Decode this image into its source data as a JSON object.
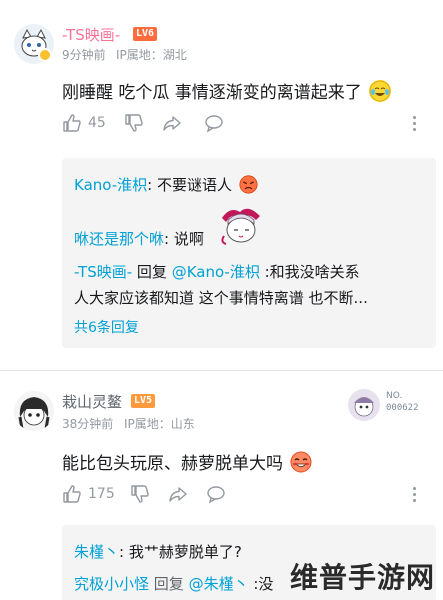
{
  "comments": [
    {
      "username": "-TS映画-",
      "level": "LV6",
      "time": "9分钟前",
      "ip": "IP属地：湖北",
      "content": "刚睡醒 吃个瓜 事情逐渐变的离谱起来了",
      "likes": "45",
      "emoji": "laughing-tears-emoji",
      "replies": [
        {
          "user": "Kano-淮枳",
          "sep": ": ",
          "text": "不要谜语人",
          "emoji": "angry-emoji"
        },
        {
          "user": "咻还是那个咻",
          "sep": ": ",
          "text": "说啊",
          "sticker": "anime-girl-sticker"
        },
        {
          "user": "-TS映画-",
          "mid": " 回复 ",
          "mention": "@Kano-淮枳",
          "text": " :和我没啥关系",
          "text2": "人大家应该都知道 这个事情特离谱 也不断..."
        }
      ],
      "more_replies": "共6条回复"
    },
    {
      "username": "栽山灵鳌",
      "level": "LV5",
      "time": "38分钟前",
      "ip": "IP属地：山东",
      "content": "能比包头玩原、赫萝脱单大吗",
      "likes": "175",
      "emoji": "blushing-emoji",
      "badge_label": "NO.",
      "badge_number": "000622",
      "replies": [
        {
          "user": "朱槿丶",
          "sep": ": ",
          "text": "我艹赫萝脱单了?"
        },
        {
          "user": "究极小小怪",
          "mid": " 回复 ",
          "mention": "@朱槿丶",
          "text": " :没"
        }
      ]
    }
  ],
  "watermark": "维普手游网",
  "colors": {
    "accent": "#fb7299",
    "link": "#00a1d6",
    "level6": "#ff6b3d",
    "level5": "#ff9a3c",
    "meta": "#9499a0",
    "reply_bg": "#f4f4f4"
  }
}
